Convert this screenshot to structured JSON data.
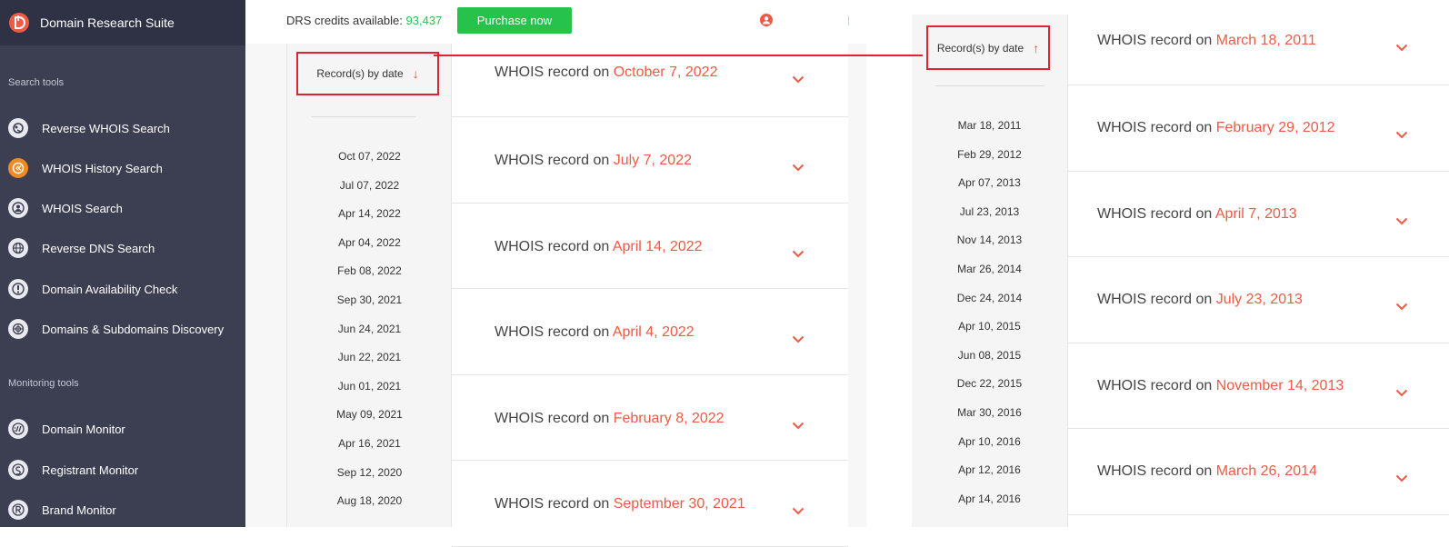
{
  "app": {
    "title": "Domain Research Suite"
  },
  "sidebar": {
    "search_tools_label": "Search tools",
    "monitoring_tools_label": "Monitoring tools",
    "search_items": [
      {
        "label": "Reverse WHOIS Search",
        "icon": "reverse-whois-icon"
      },
      {
        "label": "WHOIS History Search",
        "icon": "history-icon",
        "active": true
      },
      {
        "label": "WHOIS Search",
        "icon": "user-icon"
      },
      {
        "label": "Reverse DNS Search",
        "icon": "globe-icon"
      },
      {
        "label": "Domain Availability Check",
        "icon": "exclamation-icon"
      },
      {
        "label": "Domains & Subdomains Discovery",
        "icon": "discovery-icon"
      }
    ],
    "monitor_items": [
      {
        "label": "Domain Monitor",
        "icon": "slash-icon"
      },
      {
        "label": "Registrant Monitor",
        "icon": "registrant-icon"
      },
      {
        "label": "Brand Monitor",
        "icon": "brand-r-icon"
      }
    ]
  },
  "topbar": {
    "credits_label": "DRS credits available:",
    "credits_value": "93,437",
    "purchase_label": "Purchase now"
  },
  "left_panel": {
    "sort_label": "Record(s) by date",
    "sort_arrow": "↓",
    "dates": [
      "Oct 07, 2022",
      "Jul 07, 2022",
      "Apr 14, 2022",
      "Apr 04, 2022",
      "Feb 08, 2022",
      "Sep 30, 2021",
      "Jun 24, 2021",
      "Jun 22, 2021",
      "Jun 01, 2021",
      "May 09, 2021",
      "Apr 16, 2021",
      "Sep 12, 2020",
      "Aug 18, 2020"
    ],
    "record_prefix": "WHOIS record on",
    "records": [
      "October 7, 2022",
      "July 7, 2022",
      "April 14, 2022",
      "April 4, 2022",
      "February 8, 2022",
      "September 30, 2021"
    ]
  },
  "right_panel": {
    "sort_label": "Record(s) by date",
    "sort_arrow": "↑",
    "dates": [
      "Mar 18, 2011",
      "Feb 29, 2012",
      "Apr 07, 2013",
      "Jul 23, 2013",
      "Nov 14, 2013",
      "Mar 26, 2014",
      "Dec 24, 2014",
      "Apr 10, 2015",
      "Jun 08, 2015",
      "Dec 22, 2015",
      "Mar 30, 2016",
      "Apr 10, 2016",
      "Apr 12, 2016",
      "Apr 14, 2016"
    ],
    "record_prefix": "WHOIS record on",
    "records": [
      "March 18, 2011",
      "February 29, 2012",
      "April 7, 2013",
      "July 23, 2013",
      "November 14, 2013",
      "March 26, 2014"
    ]
  },
  "colors": {
    "accent_red": "#ef5a45",
    "highlight_box": "#e0232e",
    "purchase_green": "#27c24c",
    "credits_green": "#2ebf4f",
    "sidebar_bg": "#3c3f52"
  }
}
